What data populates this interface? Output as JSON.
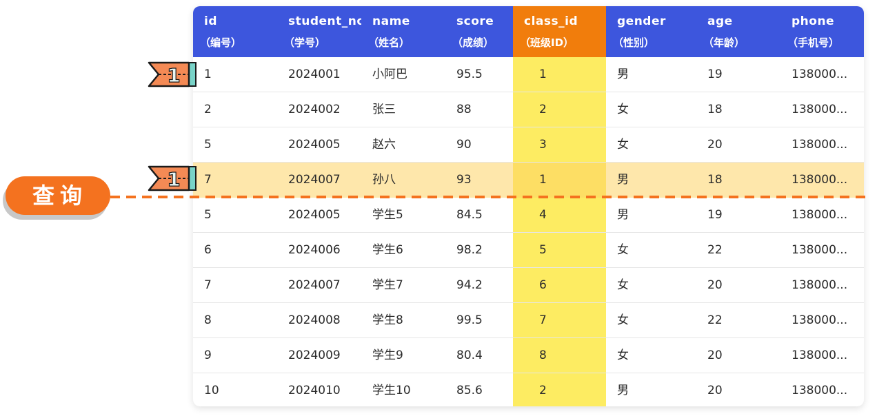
{
  "columns": [
    {
      "label": "id",
      "sub": "（编号）"
    },
    {
      "label": "student_no",
      "sub": "（学号）"
    },
    {
      "label": "name",
      "sub": "（姓名）"
    },
    {
      "label": "score",
      "sub": "（成绩）"
    },
    {
      "label": "class_id",
      "sub": "（班级ID）"
    },
    {
      "label": "gender",
      "sub": "（性别）"
    },
    {
      "label": "age",
      "sub": "（年龄）"
    },
    {
      "label": "phone",
      "sub": "（手机号）"
    }
  ],
  "rows": [
    [
      "1",
      "2024001",
      "小阿巴",
      "95.5",
      "1",
      "男",
      "19",
      "138000..."
    ],
    [
      "2",
      "2024002",
      "张三",
      "88",
      "2",
      "女",
      "18",
      "138000..."
    ],
    [
      "5",
      "2024005",
      "赵六",
      "90",
      "3",
      "女",
      "20",
      "138000..."
    ],
    [
      "7",
      "2024007",
      "孙八",
      "93",
      "1",
      "男",
      "18",
      "138000..."
    ],
    [
      "5",
      "2024005",
      "学生5",
      "84.5",
      "4",
      "男",
      "19",
      "138000..."
    ],
    [
      "6",
      "2024006",
      "学生6",
      "98.2",
      "5",
      "女",
      "22",
      "138000..."
    ],
    [
      "7",
      "2024007",
      "学生7",
      "94.2",
      "6",
      "女",
      "20",
      "138000..."
    ],
    [
      "8",
      "2024008",
      "学生8",
      "99.5",
      "7",
      "女",
      "22",
      "138000..."
    ],
    [
      "9",
      "2024009",
      "学生9",
      "80.4",
      "8",
      "女",
      "20",
      "138000..."
    ],
    [
      "10",
      "2024010",
      "学生10",
      "85.6",
      "2",
      "男",
      "20",
      "138000..."
    ]
  ],
  "highlighted_column": "class_id",
  "current_row": 4,
  "markers": [
    {
      "label": "1",
      "row": 1
    },
    {
      "label": "1",
      "row": 4
    }
  ],
  "query_button": {
    "label": "查询"
  },
  "colors": {
    "header": "#3d56dd",
    "highlight_header": "#f17d0c",
    "highlight_column": "#fdec62",
    "current_row": "#fde4a2",
    "query_accent": "#f4721f"
  }
}
